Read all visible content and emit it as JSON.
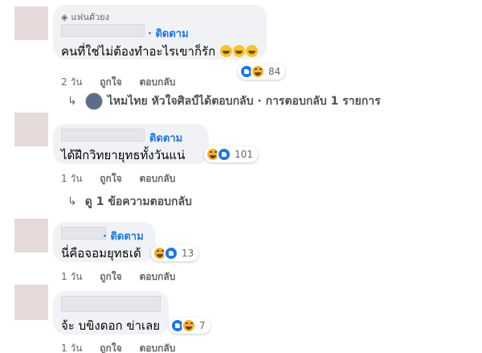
{
  "comments": [
    {
      "badge": "แฟนตัวยง",
      "badge_icon": "diamond-icon",
      "follow": "· ติดตาม",
      "text": "คนที่ใช่ไม่ต้องทำอะไรเขาก็รัก",
      "reaction_count": "84",
      "reactions": [
        "like",
        "haha"
      ],
      "time": "2 วัน",
      "like_label": "ถูกใจ",
      "reply_label": "ตอบกลับ",
      "reply_summary": {
        "author": "ไหมไทย หัวใจศิลป์",
        "text": " ได้ตอบกลับ · การตอบกลับ 1 รายการ"
      }
    },
    {
      "follow": "ติดตาม",
      "text": "ได้ฝึกวิทยายุทธทั้งวันแน่",
      "reaction_count": "101",
      "reactions": [
        "haha",
        "like"
      ],
      "time": "1 วัน",
      "like_label": "ถูกใจ",
      "reply_label": "ตอบกลับ",
      "view_replies": "ดู 1 ข้อความตอบกลับ"
    },
    {
      "follow": "· ติดตาม",
      "text": "นี่คือจอมยุทธเด้",
      "reaction_count": "13",
      "reactions": [
        "haha",
        "like"
      ],
      "time": "1 วัน",
      "like_label": "ถูกใจ",
      "reply_label": "ตอบกลับ"
    },
    {
      "text": "จ้ะ บขิงดอก ข่าเลย",
      "reaction_count": "7",
      "reactions": [
        "like",
        "haha"
      ],
      "time": "1 วัน",
      "like_label": "ถูกใจ",
      "reply_label": "ตอบกลับ"
    }
  ],
  "colors": {
    "bubble": "#f0f2f5",
    "link": "#1877f2",
    "meta": "#65676b",
    "like": "#1877f2",
    "haha": "#f7b125"
  }
}
